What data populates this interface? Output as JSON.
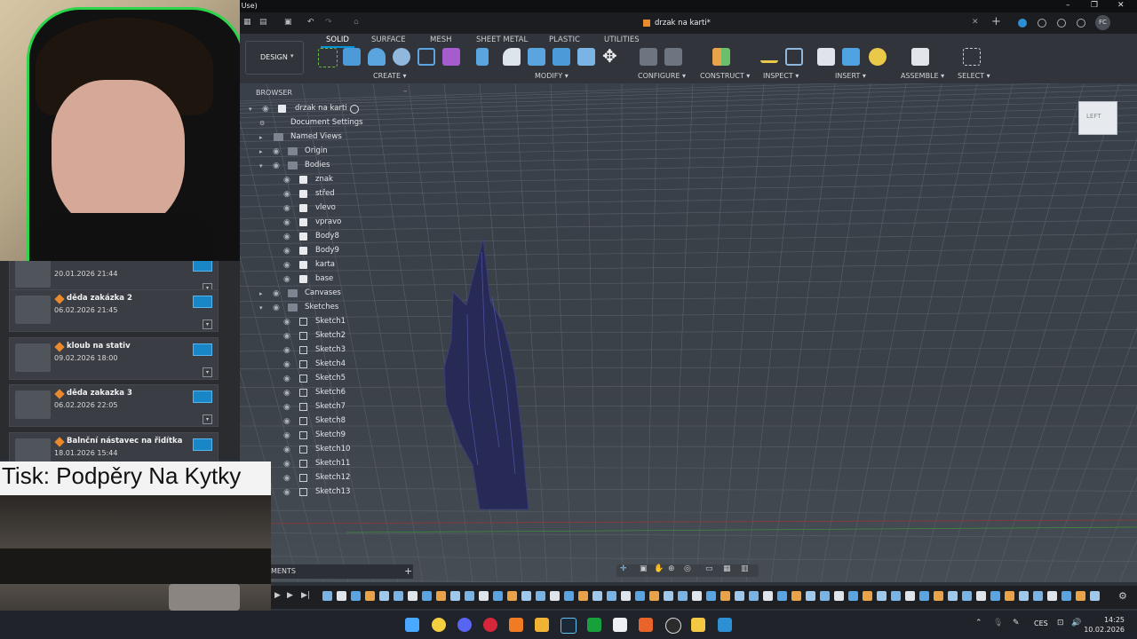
{
  "window": {
    "title_fragment": "al Use)"
  },
  "document_tab": {
    "title": "drzak na karti*"
  },
  "user_initials": "FC",
  "workspace": {
    "label": "DESIGN"
  },
  "toolbar": {
    "tabs": [
      "SOLID",
      "SURFACE",
      "MESH",
      "SHEET METAL",
      "PLASTIC",
      "UTILITIES"
    ],
    "active_tab": "SOLID",
    "groups": [
      "CREATE",
      "MODIFY",
      "CONFIGURE",
      "CONSTRUCT",
      "INSPECT",
      "INSERT",
      "ASSEMBLE",
      "SELECT"
    ]
  },
  "browser": {
    "header": "BROWSER",
    "root": "drzak na karti",
    "items": {
      "document_settings": "Document Settings",
      "named_views": "Named Views",
      "origin": "Origin",
      "bodies": "Bodies",
      "canvases": "Canvases",
      "sketches": "Sketches"
    },
    "bodies": [
      "znak",
      "střed",
      "vlevo",
      "vpravo",
      "Body8",
      "Body9",
      "karta",
      "base"
    ],
    "sketches": [
      "Sketch1",
      "Sketch2",
      "Sketch3",
      "Sketch4",
      "Sketch5",
      "Sketch6",
      "Sketch7",
      "Sketch8",
      "Sketch9",
      "Sketch10",
      "Sketch11",
      "Sketch12",
      "Sketch13"
    ]
  },
  "data_panel": {
    "cards": [
      {
        "title": "",
        "date": "20.01.2026 21:44"
      },
      {
        "title": "děda zakázka 2",
        "date": "06.02.2026 21:45"
      },
      {
        "title": "kloub na stativ",
        "date": "09.02.2026 18:00"
      },
      {
        "title": "děda zakazka 3",
        "date": "06.02.2026 22:05"
      },
      {
        "title": "Balnční nástavec na řidítka",
        "date": "18.01.2026 15:44"
      }
    ]
  },
  "overlay_text": "Tisk: Podpěry Na Kytky",
  "comments": {
    "label": "MENTS",
    "add": "+"
  },
  "viewcube": {
    "face": "LEFT"
  },
  "taskbar": {
    "language": "CES",
    "time": "14:25",
    "date": "10.02.2026"
  }
}
